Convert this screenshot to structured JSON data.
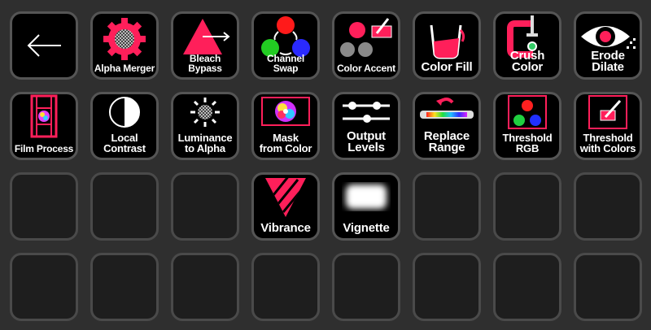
{
  "colors": {
    "accent": "#ff1f5a",
    "background": "#2f2f2f",
    "key_empty": "#1e1e1e",
    "key_active": "#000000"
  },
  "keys": [
    {
      "label": "",
      "icon": "back-arrow-icon"
    },
    {
      "label": "Alpha Merger",
      "icon": "gear-icon"
    },
    {
      "label": "Bleach Bypass",
      "icon": "triangle-arrow-icon"
    },
    {
      "label": "Channel Swap",
      "icon": "rgb-swap-icon"
    },
    {
      "label": "Color Accent",
      "icon": "color-accent-icon"
    },
    {
      "label": "Color Fill",
      "icon": "fill-bucket-icon"
    },
    {
      "label": "Crush Color",
      "icon": "clamp-icon"
    },
    {
      "label": "Erode Dilate",
      "icon": "eye-icon"
    },
    {
      "label": "Film Process",
      "icon": "film-strip-icon"
    },
    {
      "label": "Local\nContrast",
      "icon": "contrast-icon"
    },
    {
      "label": "Luminance\nto Alpha",
      "icon": "sun-checker-icon"
    },
    {
      "label": "Mask\nfrom Color",
      "icon": "color-wheel-icon"
    },
    {
      "label": "Output\nLevels",
      "icon": "sliders-icon"
    },
    {
      "label": "Replace\nRange",
      "icon": "spectrum-bar-icon"
    },
    {
      "label": "Threshold\nRGB",
      "icon": "rgb-dots-icon"
    },
    {
      "label": "Threshold\nwith Colors",
      "icon": "eyedropper-frame-icon"
    },
    {
      "label": "Vibrance",
      "icon": "striped-triangle-icon"
    },
    {
      "label": "Vignette",
      "icon": "vignette-icon"
    }
  ]
}
